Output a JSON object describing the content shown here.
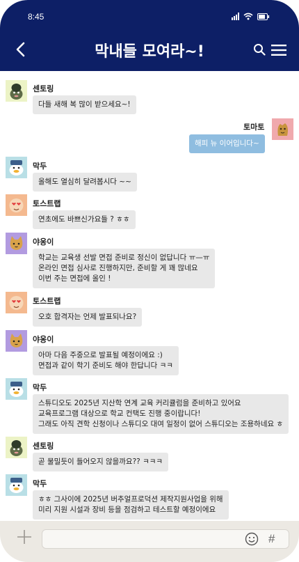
{
  "status": {
    "time": "8:45"
  },
  "header": {
    "title": "막내들 모여라~!"
  },
  "messages": [
    {
      "sender": "센토링",
      "text": "다들 새해 복 많이 받으세요~!",
      "avatar": "cactus-character-avatar"
    },
    {
      "sender": "토마토",
      "text": "해피 뉴 이어입니다~",
      "avatar": "tomato-character-avatar"
    },
    {
      "sender": "막두",
      "text": "올해도 열심히 달려봅시다 ~~",
      "avatar": "duck-character-avatar"
    },
    {
      "sender": "토스트랩",
      "text": "연초에도 바쁘신가요들 ? ㅎㅎ",
      "avatar": "heart-eyes-character-avatar"
    },
    {
      "sender": "야옹이",
      "text": "학교는 교육생 선발 면접 준비로 정신이 없답니다 ㅠ—ㅠ\n온라인 면접 심사로 진행하지만, 준비할 게 꽤 많네요\n이번 주는 면접에 올인 !",
      "avatar": "cat-character-avatar"
    },
    {
      "sender": "토스트랩",
      "text": "오호 합격자는 언제 발표되나요?",
      "avatar": "heart-eyes-character-avatar"
    },
    {
      "sender": "야옹이",
      "text": "아마 다음 주중으로 발표될 예정이에요 :)\n면접과 같이 학기 준비도 해야 한답니다 ㅋㅋ",
      "avatar": "cat-character-avatar"
    },
    {
      "sender": "막두",
      "text": "스튜디오도 2025년 지산학 연계 교육 커리큘럼을 준비하고 있어요\n교육프로그램 대상으로 학교 컨택도 진행 중이랍니다!\n그래도 아직 견학 신청이나 스튜디오 대여 일정이 없어 스튜디오는 조용하네요 ㅎ",
      "avatar": "duck-character-avatar"
    },
    {
      "sender": "센토링",
      "text": "곧 물밀듯이 들어오지 않을까요?? ㅋㅋㅋ",
      "avatar": "cactus-character-avatar"
    },
    {
      "sender": "막두",
      "text": "ㅎㅎ 그사이에 2025년 버추얼프로덕션 제작지원사업을 위해\n미리 지원 시설과 장비 등을 점검하고 테스트할 예정이에요",
      "avatar": "duck-character-avatar"
    }
  ],
  "icons": {
    "back": "chevron-left-icon",
    "search": "search-icon",
    "menu": "hamburger-menu-icon",
    "attach": "plus-icon",
    "emoji": "smiley-icon",
    "hashtag": "hash-icon"
  },
  "composer": {
    "hashtag": "#"
  },
  "colors": {
    "header": "#0d1f66",
    "bubble": "#e8e8e8",
    "my_bubble": "#8fbde0",
    "composer_bar": "#ece9e3"
  }
}
